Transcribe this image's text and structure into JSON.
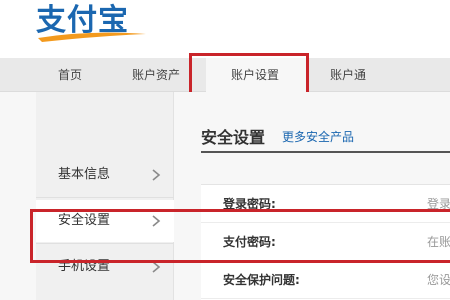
{
  "brand": {
    "logo_text": "支付宝",
    "colors": {
      "blue": "#1b67b0",
      "orange": "#f39a1e",
      "highlight": "#c9242a"
    }
  },
  "nav": {
    "items": [
      {
        "label": "首页"
      },
      {
        "label": "账户资产"
      },
      {
        "label": "账户设置",
        "active": true
      },
      {
        "label": "账户通"
      }
    ]
  },
  "sidebar": {
    "items": [
      {
        "label": "基本信息",
        "icon": "chevron-right-icon"
      },
      {
        "label": "安全设置",
        "icon": "chevron-right-icon",
        "active": true
      },
      {
        "label": "手机设置",
        "icon": "chevron-right-icon"
      }
    ]
  },
  "content": {
    "title": "安全设置",
    "more_link": "更多安全产品",
    "rows": [
      {
        "label": "登录密码:",
        "value": "登录"
      },
      {
        "label": "支付密码:",
        "value": "在账"
      },
      {
        "label": "安全保护问题:",
        "value": "您设"
      }
    ]
  }
}
